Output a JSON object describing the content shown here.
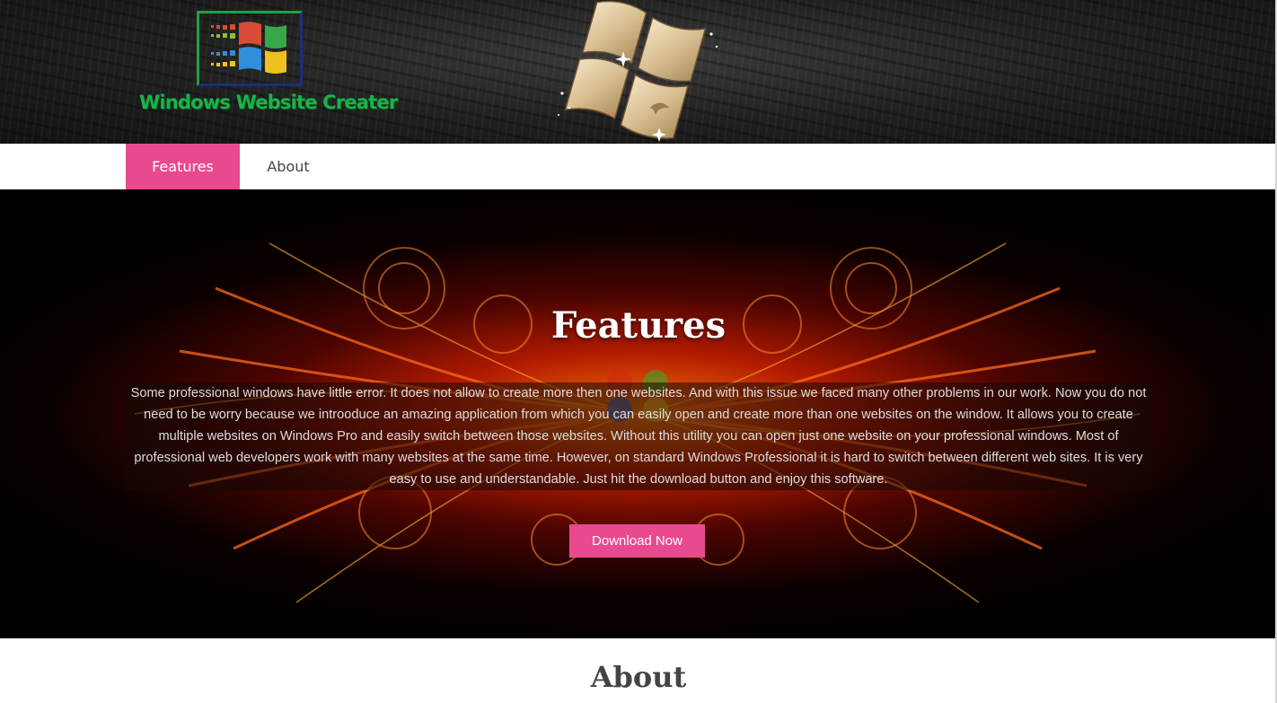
{
  "header": {
    "logo_text": "Windows Website Creater"
  },
  "nav": {
    "items": [
      {
        "label": "Features",
        "active": true
      },
      {
        "label": "About",
        "active": false
      }
    ]
  },
  "hero": {
    "title": "Features",
    "description": "Some professional windows have little error. It does not allow to create more then one websites. And with this issue we faced many other problems in our work. Now you do not need to be worry because we introoduce an amazing application from which you can easily open and create more than one websites on the window. It allows you to create multiple websites on Windows Pro and easily switch between those websites. Without this utility you can open just one website on your professional windows. Most of professional web developers work with many websites at the same time. However, on standard Windows Professional it is hard to switch between different web sites. It is very easy to use and understandable. Just hit the download button and enjoy this software.",
    "button_label": "Download Now"
  },
  "about": {
    "title": "About"
  },
  "colors": {
    "accent": "#e94a8f",
    "logo_green": "#19b34a",
    "text_dark": "#444444"
  }
}
